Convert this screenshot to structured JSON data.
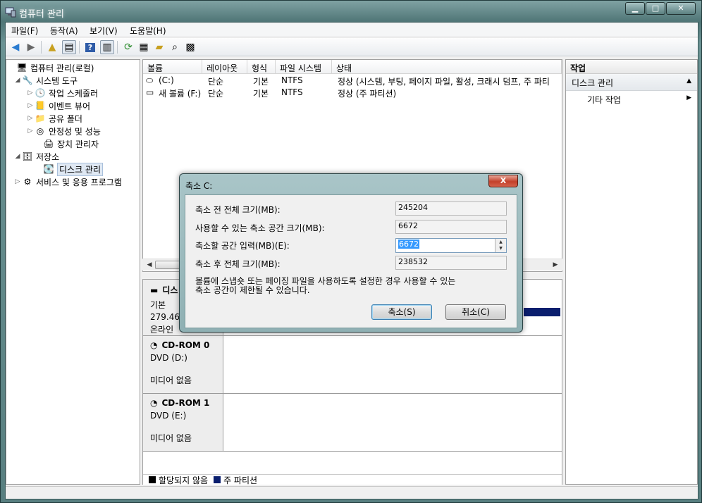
{
  "window": {
    "title": "컴퓨터 관리"
  },
  "menu": [
    "파일(F)",
    "동작(A)",
    "보기(V)",
    "도움말(H)"
  ],
  "tree": {
    "root": "컴퓨터 관리(로컬)",
    "system_tools": "시스템 도구",
    "task_scheduler": "작업 스케줄러",
    "event_viewer": "이벤트 뷰어",
    "shared_folders": "공유 폴더",
    "reliability": "안정성 및 성능",
    "device_manager": "장치 관리자",
    "storage": "저장소",
    "disk_management": "디스크 관리",
    "services": "서비스 및 응용 프로그램"
  },
  "volumes": {
    "columns": [
      "볼륨",
      "레이아웃",
      "형식",
      "파일 시스템",
      "상태"
    ],
    "rows": [
      {
        "name": "(C:)",
        "layout": "단순",
        "type": "기본",
        "fs": "NTFS",
        "status": "정상 (시스템, 부팅, 페이지 파일, 활성, 크래시 덤프, 주 파티"
      },
      {
        "name": "새 볼륨 (F:)",
        "layout": "단순",
        "type": "기본",
        "fs": "NTFS",
        "status": "정상 (주 파티션)"
      }
    ]
  },
  "disks": {
    "disk0": {
      "name": "디스",
      "type": "기본",
      "size": "279.46",
      "state": "온라인"
    },
    "cdrom0": {
      "name": "CD-ROM 0",
      "drive": "DVD (D:)",
      "media": "미디어 없음"
    },
    "cdrom1": {
      "name": "CD-ROM 1",
      "drive": "DVD (E:)",
      "media": "미디어 없음"
    }
  },
  "legend": {
    "unallocated": "할당되지 않음",
    "primary": "주 파티션"
  },
  "actions": {
    "header": "작업",
    "section": "디스크 관리",
    "more": "기타 작업"
  },
  "dialog": {
    "title": "축소 C:",
    "total_before_label": "축소 전 전체 크기(MB):",
    "total_before_value": "245204",
    "available_label": "사용할 수 있는 축소 공간 크기(MB):",
    "available_value": "6672",
    "input_label": "축소할 공간 입력(MB)(E):",
    "input_value": "6672",
    "total_after_label": "축소 후 전체 크기(MB):",
    "total_after_value": "238532",
    "note_line1": "볼륨에 스냅숏 또는 페이징 파일을 사용하도록 설정한 경우 사용할 수 있는",
    "note_line2": "축소 공간이 제한될 수 있습니다.",
    "shrink_button": "축소(S)",
    "cancel_button": "취소(C)",
    "close_glyph": "X"
  },
  "colors": {
    "unallocated": "#000000",
    "primary": "#0a1e6e",
    "selection": "#3399ff"
  }
}
